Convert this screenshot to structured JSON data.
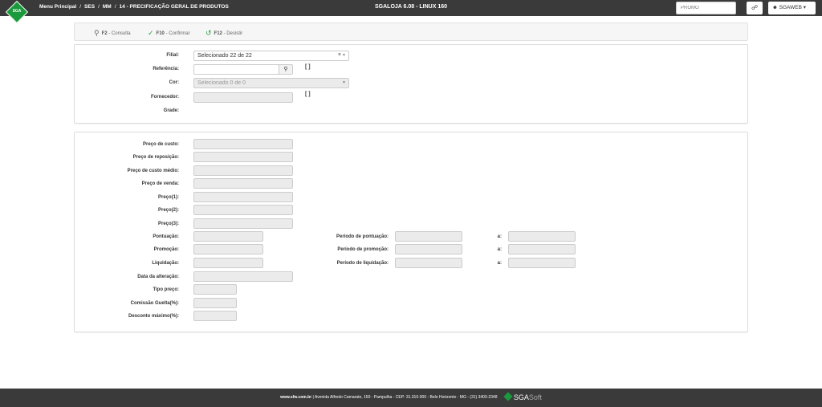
{
  "header": {
    "logo_text": "SGA",
    "breadcrumb": [
      "Menu Principal",
      "SES",
      "MM",
      "14 - PRECIFICAÇÃO GERAL DE PRODUTOS"
    ],
    "breadcrumb_sep": "/",
    "app_title": "SGALOJA 6.08 - LINUX 160",
    "promo_value": "PROMO",
    "help_icon": "headset-icon",
    "user_label": "SGAWEB",
    "user_icon": "user-cog-icon"
  },
  "toolbar": {
    "consulta_key": "F2",
    "consulta_label": "- Consulta",
    "confirmar_key": "F10",
    "confirmar_label": "- Confirmar",
    "desistir_key": "F12",
    "desistir_label": "- Desistir",
    "colors": {
      "search": "#666666",
      "check": "#2e9e3e",
      "undo": "#2e9e3e"
    }
  },
  "filters": {
    "filial_label": "Filial:",
    "filial_value": "Selecionado 22 de 22",
    "referencia_label": "Referência:",
    "referencia_value": "",
    "cor_label": "Cor:",
    "cor_value": "Selecionado 0 de 0",
    "fornecedor_label": "Fornecedor:",
    "fornecedor_value": "",
    "grade_label": "Grade:",
    "bracket": "[ ]"
  },
  "prices": {
    "preco_custo": "Preço de custo:",
    "preco_reposicao": "Preço de reposição:",
    "preco_custo_medio": "Preço de custo médio:",
    "preco_venda": "Preço de venda:",
    "preco1": "Preço(1):",
    "preco2": "Preço(2):",
    "preco3": "Preço(3):",
    "pontuacao": "Pontuação:",
    "promocao": "Promoção:",
    "liquidacao": "Liquidação:",
    "data_alteracao": "Data da alteração:",
    "tipo_preco": "Tipo preço:",
    "comissao": "Comissão Guelta(%):",
    "desconto": "Desconto máximo(%):",
    "periodo_pontuacao": "Período de pontuação:",
    "periodo_promocao": "Período de promoção:",
    "periodo_liquidacao": "Período de liquidação:",
    "a": "a:"
  },
  "footer": {
    "site": "www.sfw.com.br",
    "address": "|  Avenida Alfredo Camarate, 150 - Pampulha - CEP: 31.310-000 - Belo Horizonte - MG - (31) 3403-2348",
    "brand_a": "SGA",
    "brand_b": "Soft"
  }
}
